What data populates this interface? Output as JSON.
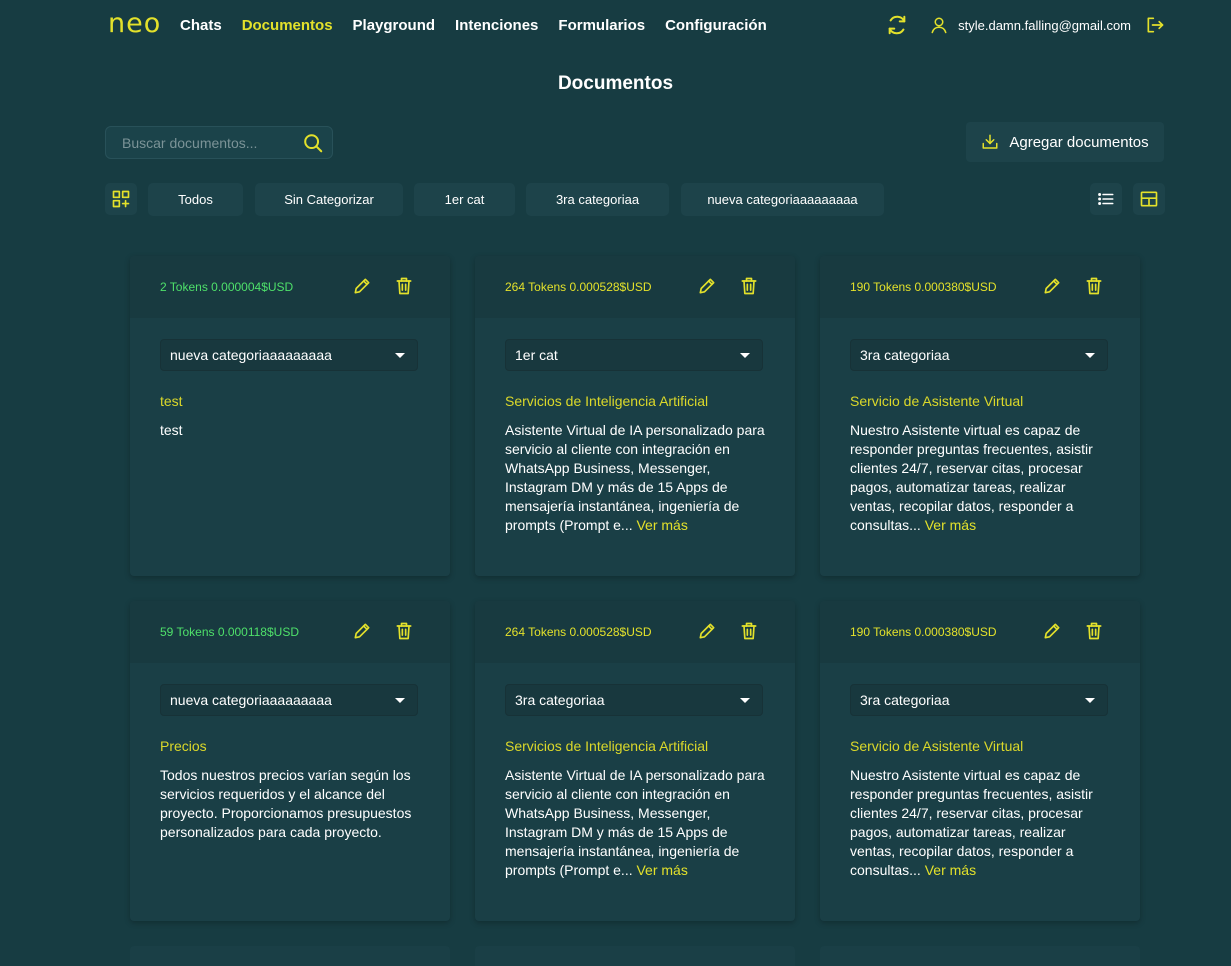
{
  "nav": {
    "logo": "neo",
    "links": [
      "Chats",
      "Documentos",
      "Playground",
      "Intenciones",
      "Formularios",
      "Configuración"
    ],
    "active": "Documentos",
    "email": "style.damn.falling@gmail.com"
  },
  "page": {
    "title": "Documentos"
  },
  "search": {
    "placeholder": "Buscar documentos..."
  },
  "add_button": {
    "label": "Agregar documentos"
  },
  "filters": [
    "Todos",
    "Sin Categorizar",
    "1er cat",
    "3ra categoriaa",
    "nueva categoriaaaaaaaaa"
  ],
  "colors": {
    "accent": "#e3e12b",
    "tokens_green": "#4ee06a",
    "background": "#173c42",
    "card": "#1a3f46"
  },
  "cards": [
    {
      "tokens": "2 Tokens 0.000004$USD",
      "tokens_color": "green",
      "category": "nueva categoriaaaaaaaaa",
      "title": "test",
      "body": "test",
      "more": ""
    },
    {
      "tokens": "264 Tokens 0.000528$USD",
      "tokens_color": "yellow",
      "category": "1er cat",
      "title": "Servicios de Inteligencia Artificial",
      "body": "Asistente Virtual de IA personalizado para servicio al cliente con integración en WhatsApp Business, Messenger, Instagram DM y más de 15 Apps de mensajería instantánea, ingeniería de prompts (Prompt e...",
      "more": "Ver más"
    },
    {
      "tokens": "190 Tokens 0.000380$USD",
      "tokens_color": "yellow",
      "category": "3ra categoriaa",
      "title": "Servicio de Asistente Virtual",
      "body": "Nuestro Asistente virtual es capaz de responder preguntas frecuentes, asistir clientes 24/7, reservar citas, procesar pagos, automatizar tareas, realizar ventas, recopilar datos, responder a consultas...",
      "more": "Ver más"
    },
    {
      "tokens": "59 Tokens 0.000118$USD",
      "tokens_color": "green",
      "category": "nueva categoriaaaaaaaaa",
      "title": "Precios",
      "body": "Todos nuestros precios varían según los servicios requeridos y el alcance del proyecto. Proporcionamos presupuestos personalizados para cada proyecto.",
      "more": ""
    },
    {
      "tokens": "264 Tokens 0.000528$USD",
      "tokens_color": "yellow",
      "category": "3ra categoriaa",
      "title": "Servicios de Inteligencia Artificial",
      "body": "Asistente Virtual de IA personalizado para servicio al cliente con integración en WhatsApp Business, Messenger, Instagram DM y más de 15 Apps de mensajería instantánea, ingeniería de prompts (Prompt e...",
      "more": "Ver más"
    },
    {
      "tokens": "190 Tokens 0.000380$USD",
      "tokens_color": "yellow",
      "category": "3ra categoriaa",
      "title": "Servicio de Asistente Virtual",
      "body": "Nuestro Asistente virtual es capaz de responder preguntas frecuentes, asistir clientes 24/7, reservar citas, procesar pagos, automatizar tareas, realizar ventas, recopilar datos, responder a consultas...",
      "more": "Ver más"
    }
  ]
}
